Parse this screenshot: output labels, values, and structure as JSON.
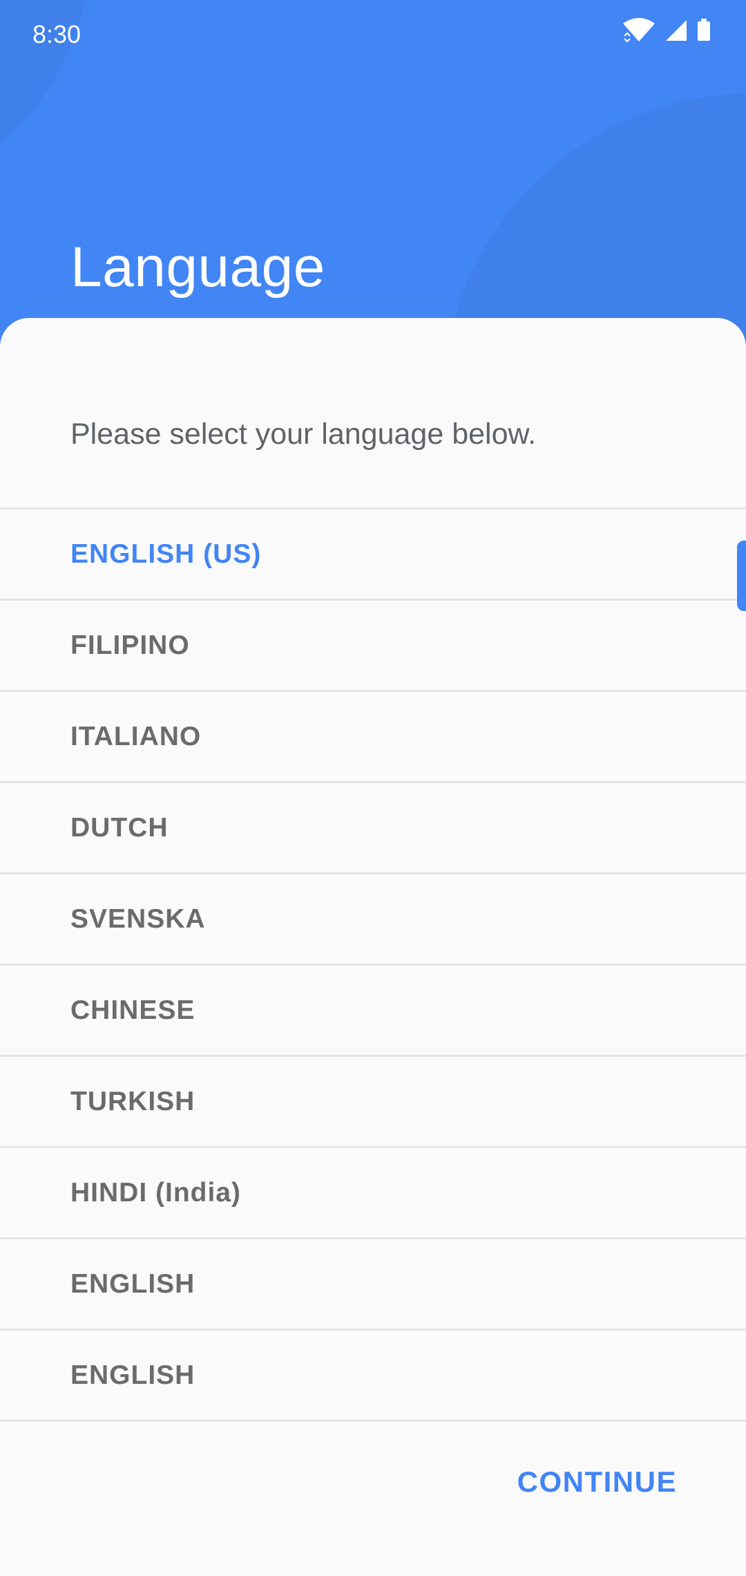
{
  "status_bar": {
    "time": "8:30",
    "icons": [
      "wifi-icon",
      "cell-signal-icon",
      "battery-icon"
    ]
  },
  "header": {
    "title": "Language"
  },
  "content": {
    "subtitle": "Please select your language below.",
    "languages": [
      {
        "label": "ENGLISH  (US)",
        "selected": true
      },
      {
        "label": "FILIPINO",
        "selected": false
      },
      {
        "label": "ITALIANO",
        "selected": false
      },
      {
        "label": "DUTCH",
        "selected": false
      },
      {
        "label": "SVENSKA",
        "selected": false
      },
      {
        "label": "CHINESE",
        "selected": false
      },
      {
        "label": "TURKISH",
        "selected": false
      },
      {
        "label": "HINDI  (India)",
        "selected": false
      },
      {
        "label": "ENGLISH",
        "selected": false
      },
      {
        "label": "ENGLISH",
        "selected": false
      }
    ]
  },
  "footer": {
    "continue_label": "CONTINUE"
  },
  "colors": {
    "accent": "#4285f4",
    "header_bg": "#4285f4",
    "sheet_bg": "#fafafa",
    "item_text": "#6b6b6b",
    "divider": "#e3e3e3"
  }
}
